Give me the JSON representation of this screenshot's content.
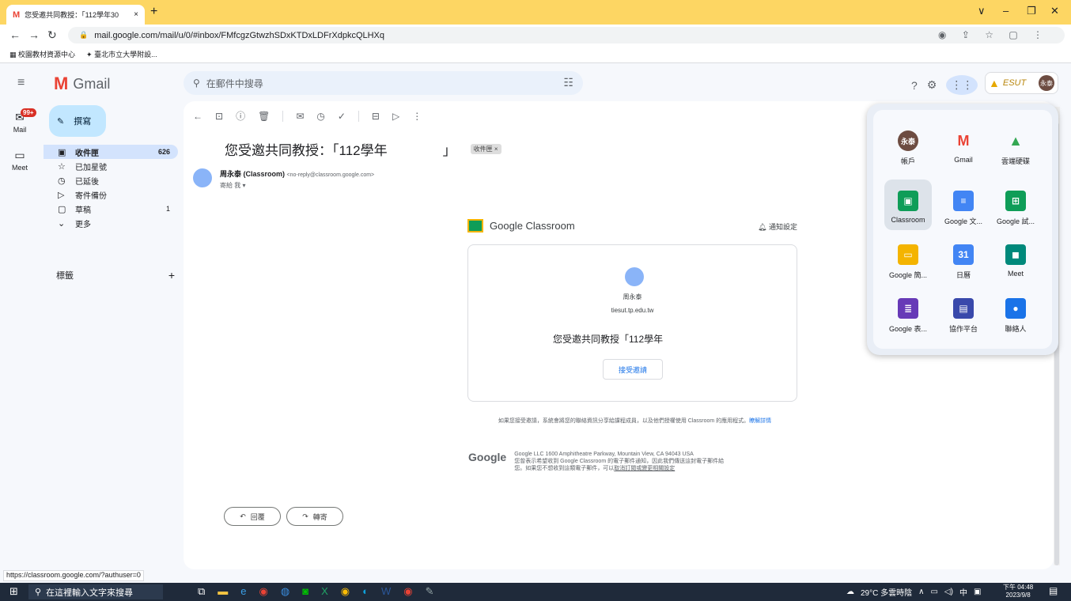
{
  "browser": {
    "tab_title": "您受邀共同教授：「112學年30",
    "tab_close": "×",
    "new_tab": "+",
    "url": "mail.google.com/mail/u/0/#inbox/FMfcgzGtwzhSDxKTDxLDFrXdpkcQLHXq",
    "bookmarks": [
      "校園教材資源中心",
      "臺北市立大學附設..."
    ],
    "window_controls": [
      "∨",
      "–",
      "❐",
      "✕"
    ]
  },
  "gmail": {
    "logo_text": "Gmail",
    "search_placeholder": "在郵件中搜尋",
    "brand_text": "ESUT",
    "avatar_text": "永泰",
    "rail": {
      "mail_label": "Mail",
      "mail_badge": "99+",
      "meet_label": "Meet"
    },
    "compose_label": "撰寫",
    "folders": [
      {
        "label": "收件匣",
        "count": "626",
        "icon": "inbox-icon",
        "glyph": "▣"
      },
      {
        "label": "已加星號",
        "count": "",
        "icon": "star-icon",
        "glyph": "☆"
      },
      {
        "label": "已延後",
        "count": "",
        "icon": "clock-icon",
        "glyph": "◷"
      },
      {
        "label": "寄件備份",
        "count": "",
        "icon": "send-icon",
        "glyph": "▷"
      },
      {
        "label": "草稿",
        "count": "1",
        "icon": "draft-icon",
        "glyph": "▢"
      },
      {
        "label": "更多",
        "count": "",
        "icon": "chevron-down-icon",
        "glyph": "⌄"
      }
    ],
    "labels_heading": "標籤",
    "labels_add": "+"
  },
  "message": {
    "subject": "您受邀共同教授：「112學年",
    "subject_suffix": "」",
    "label_tag": "收件匣 ×",
    "sender_name": "周永泰 (Classroom)",
    "sender_email": "<no-reply@classroom.google.com>",
    "to_line": "寄給 我 ▾",
    "classroom_brand": "Google Classroom",
    "notify_settings": "通知設定",
    "inviter_name": "周永泰",
    "inviter_email": "tiesut.tp.edu.tw",
    "invite_text": "您受邀共同教授「112學年",
    "accept_button": "接受邀請",
    "note_text": "如果您接受邀請，系統會將您的聯絡資訊分享給課程成員，以及他們授權使用 Classroom 的應用程式。",
    "note_link": "瞭解詳情",
    "footer_google": "Google",
    "footer_address": "Google LLC 1600 Amphitheatre Parkway, Mountain View, CA 94043 USA",
    "footer_line2": "您曾表示希望收到 Google Classroom 的電子郵件通知，因此我們傳送這封電子郵件給",
    "footer_line3": "您。如果您不想收到這類電子郵件，可以",
    "footer_link": "取消訂閱或變更相關設定",
    "reply_button": "回覆",
    "forward_button": "轉寄"
  },
  "apps": [
    {
      "label": "帳戶",
      "glyph": "永泰",
      "color": "#6d4c41"
    },
    {
      "label": "Gmail",
      "glyph": "M",
      "color": "#ea4335"
    },
    {
      "label": "雲端硬碟",
      "glyph": "▲",
      "color": "#34a853"
    },
    {
      "label": "Classroom",
      "glyph": "▣",
      "color": "#0f9d58"
    },
    {
      "label": "Google 文...",
      "glyph": "≡",
      "color": "#4285f4"
    },
    {
      "label": "Google 試...",
      "glyph": "⊞",
      "color": "#0f9d58"
    },
    {
      "label": "Google 簡...",
      "glyph": "▭",
      "color": "#f4b400"
    },
    {
      "label": "日曆",
      "glyph": "31",
      "color": "#4285f4"
    },
    {
      "label": "Meet",
      "glyph": "◼",
      "color": "#00897b"
    },
    {
      "label": "Google 表...",
      "glyph": "≣",
      "color": "#673ab7"
    },
    {
      "label": "協作平台",
      "glyph": "▤",
      "color": "#3949ab"
    },
    {
      "label": "聯絡人",
      "glyph": "●",
      "color": "#1a73e8"
    }
  ],
  "status_url": "https://classroom.google.com/?authuser=0",
  "taskbar": {
    "search_placeholder": "在這裡輸入文字來搜尋",
    "weather": "29°C 多雲時陰",
    "ime": "中",
    "time": "下午 04:48",
    "date": "2023/9/8"
  }
}
